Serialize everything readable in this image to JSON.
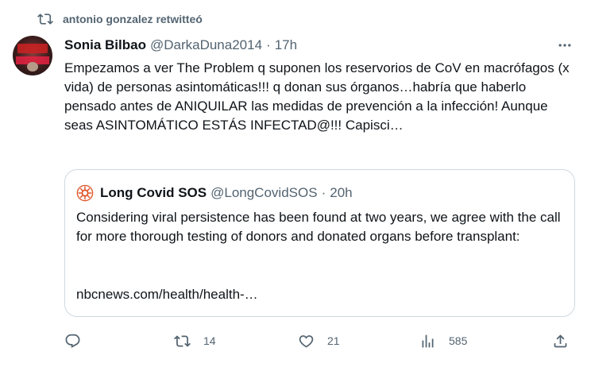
{
  "retweet": {
    "icon": "retweet-icon",
    "text": "antonio gonzalez retwitteó"
  },
  "tweet": {
    "author_name": "Sonia Bilbao",
    "author_handle": "@DarkaDuna2014",
    "separator": "·",
    "time": "17h",
    "text": "Empezamos a ver The Problem q suponen los reservorios de CoV en macrófagos (x vida) de personas asintomáticas!!! q donan sus órganos…habría que haberlo pensado antes de ANIQUILAR las medidas de prevención a la infección! Aunque seas ASINTOMÁTICO ESTÁS INFECTAD@!!! Capisci…"
  },
  "quote": {
    "author_name": "Long Covid SOS",
    "author_handle": "@LongCovidSOS",
    "separator": "·",
    "time": "20h",
    "text": "Considering viral persistence has been found at two years, we agree with the call for more thorough testing of donors and donated organs before transplant:",
    "link": "nbcnews.com/health/health-…"
  },
  "actions": {
    "reply_count": "",
    "retweet_count": "14",
    "like_count": "21",
    "views_count": "585"
  },
  "colors": {
    "text": "#0f1419",
    "secondary": "#536471",
    "border": "#cfd9de",
    "quote_logo": "#e0562b"
  }
}
